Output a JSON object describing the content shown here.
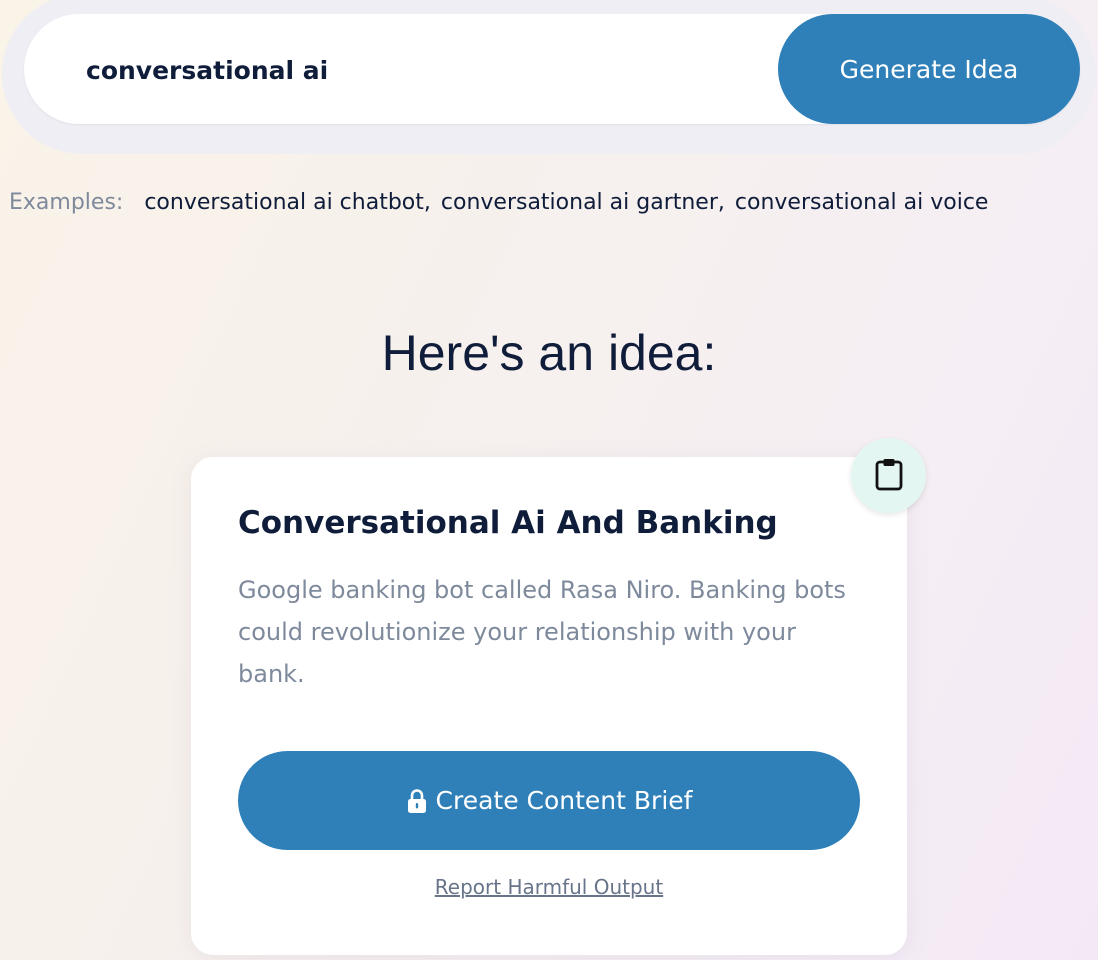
{
  "search": {
    "value": "conversational ai",
    "button_label": "Generate Idea"
  },
  "examples": {
    "label": "Examples:",
    "items": [
      {
        "text": "conversational ai chatbot",
        "sep": ","
      },
      {
        "text": "conversational ai gartner",
        "sep": ","
      },
      {
        "text": "conversational ai voice",
        "sep": ""
      }
    ]
  },
  "heading": "Here's an idea:",
  "idea": {
    "title": "Conversational Ai And Banking",
    "description": "Google banking bot called Rasa Niro. Banking bots could revolutionize your relationship with your bank.",
    "copy_icon": "clipboard-icon",
    "brief_button_label": "Create Content Brief",
    "brief_button_icon": "lock-icon",
    "report_link": "Report Harmful Output"
  },
  "colors": {
    "accent": "#2f80b9",
    "text_dark": "#0f1d3a",
    "text_muted": "#7e8a9c",
    "copy_button_bg": "#e4f6f2"
  }
}
